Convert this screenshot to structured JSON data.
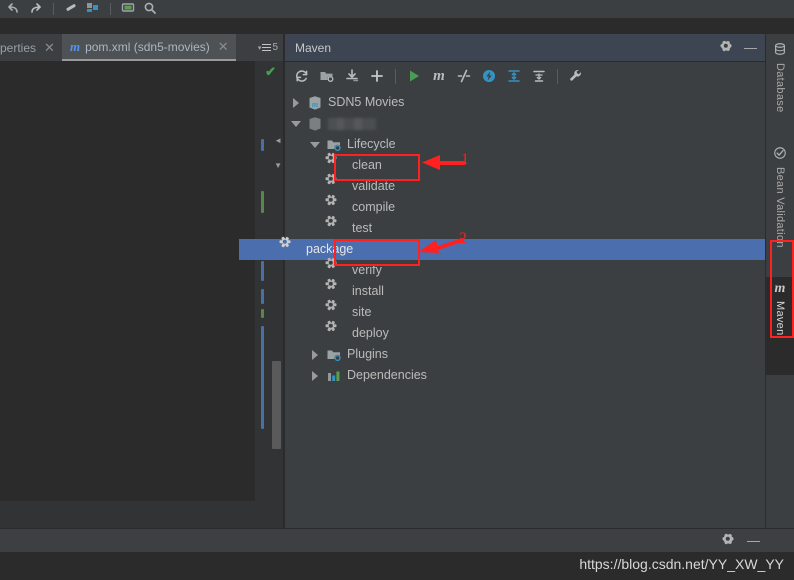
{
  "main_toolbar": {
    "icons": [
      "undo-icon",
      "redo-icon",
      "divider",
      "wand-icon",
      "run-configs-icon",
      "divider2",
      "screenshot-icon",
      "search-icon"
    ]
  },
  "editor": {
    "tabs": [
      {
        "label": "perties",
        "close_label": "✕",
        "icon": "",
        "active": false
      },
      {
        "label": "pom.xml (sdn5-movies)",
        "close_label": "✕",
        "icon": "maven-m-icon",
        "active": true
      }
    ],
    "tab_extra": {
      "caret": "▾",
      "count": "5"
    },
    "inspection_ok": "✔"
  },
  "maven": {
    "title": "Maven",
    "header_buttons": [
      {
        "name": "settings-gear-button",
        "glyph": "gear"
      },
      {
        "name": "hide-button",
        "glyph": "—"
      }
    ],
    "toolbar": [
      {
        "name": "reimport-icon",
        "title": "Reimport All Maven Projects"
      },
      {
        "name": "generate-sources-icon",
        "title": "Generate Sources and Update Folders"
      },
      {
        "name": "download-sources-icon",
        "title": "Download Sources and/or Documentation"
      },
      {
        "name": "add-maven-project-icon",
        "title": "Add Maven Projects"
      },
      {
        "name": "run-icon",
        "title": "Run"
      },
      {
        "name": "execute-maven-goal-icon",
        "title": "Execute Maven Goal"
      },
      {
        "name": "toggle-skip-tests-icon",
        "title": "Toggle Skip Tests Mode"
      },
      {
        "name": "toggle-offline-icon",
        "title": "Toggle Offline Mode"
      },
      {
        "name": "collapse-all-icon",
        "title": "Collapse All"
      },
      {
        "name": "expand-all-icon",
        "title": "Expand All"
      },
      {
        "name": "maven-settings-icon",
        "title": "Maven Settings"
      }
    ],
    "tree": [
      {
        "label": "SDN5 Movies",
        "indent": 0,
        "arrow": "right",
        "icon": "maven-project-icon",
        "selected": false,
        "blurred": false
      },
      {
        "label": "",
        "indent": 0,
        "arrow": "down",
        "icon": "maven-module-icon",
        "selected": false,
        "blurred": true
      },
      {
        "label": "Lifecycle",
        "indent": 1,
        "arrow": "down",
        "icon": "lifecycle-folder-icon",
        "selected": false,
        "blurred": false
      },
      {
        "label": "clean",
        "indent": 2,
        "arrow": "none",
        "icon": "goal-gear-icon",
        "selected": false,
        "blurred": false
      },
      {
        "label": "validate",
        "indent": 2,
        "arrow": "none",
        "icon": "goal-gear-icon",
        "selected": false,
        "blurred": false
      },
      {
        "label": "compile",
        "indent": 2,
        "arrow": "none",
        "icon": "goal-gear-icon",
        "selected": false,
        "blurred": false
      },
      {
        "label": "test",
        "indent": 2,
        "arrow": "none",
        "icon": "goal-gear-icon",
        "selected": false,
        "blurred": false
      },
      {
        "label": "package",
        "indent": 2,
        "arrow": "none",
        "icon": "goal-gear-icon",
        "selected": true,
        "blurred": false
      },
      {
        "label": "verify",
        "indent": 2,
        "arrow": "none",
        "icon": "goal-gear-icon",
        "selected": false,
        "blurred": false
      },
      {
        "label": "install",
        "indent": 2,
        "arrow": "none",
        "icon": "goal-gear-icon",
        "selected": false,
        "blurred": false
      },
      {
        "label": "site",
        "indent": 2,
        "arrow": "none",
        "icon": "goal-gear-icon",
        "selected": false,
        "blurred": false
      },
      {
        "label": "deploy",
        "indent": 2,
        "arrow": "none",
        "icon": "goal-gear-icon",
        "selected": false,
        "blurred": false
      },
      {
        "label": "Plugins",
        "indent": 1,
        "arrow": "right",
        "icon": "plugins-folder-icon",
        "selected": false,
        "blurred": false
      },
      {
        "label": "Dependencies",
        "indent": 1,
        "arrow": "right",
        "icon": "dependencies-icon",
        "selected": false,
        "blurred": false
      }
    ]
  },
  "right_tool_bar": {
    "tabs": [
      {
        "label": "Database",
        "icon": "database-icon",
        "active": false
      },
      {
        "label": "Bean Validation",
        "icon": "bean-validation-icon",
        "active": false
      },
      {
        "label": "Maven",
        "icon": "maven-m-icon",
        "active": true
      }
    ]
  },
  "status": {
    "gear_glyph": "gear",
    "hide_glyph": "—"
  },
  "watermark": "https://blog.csdn.net/YY_XW_YY",
  "annotations": {
    "accent_color": "#ff2020",
    "items": [
      {
        "number": "1",
        "target": "clean"
      },
      {
        "number": "2",
        "target": "package"
      },
      {
        "number": "",
        "target": "maven-tool-window-tab"
      }
    ]
  }
}
